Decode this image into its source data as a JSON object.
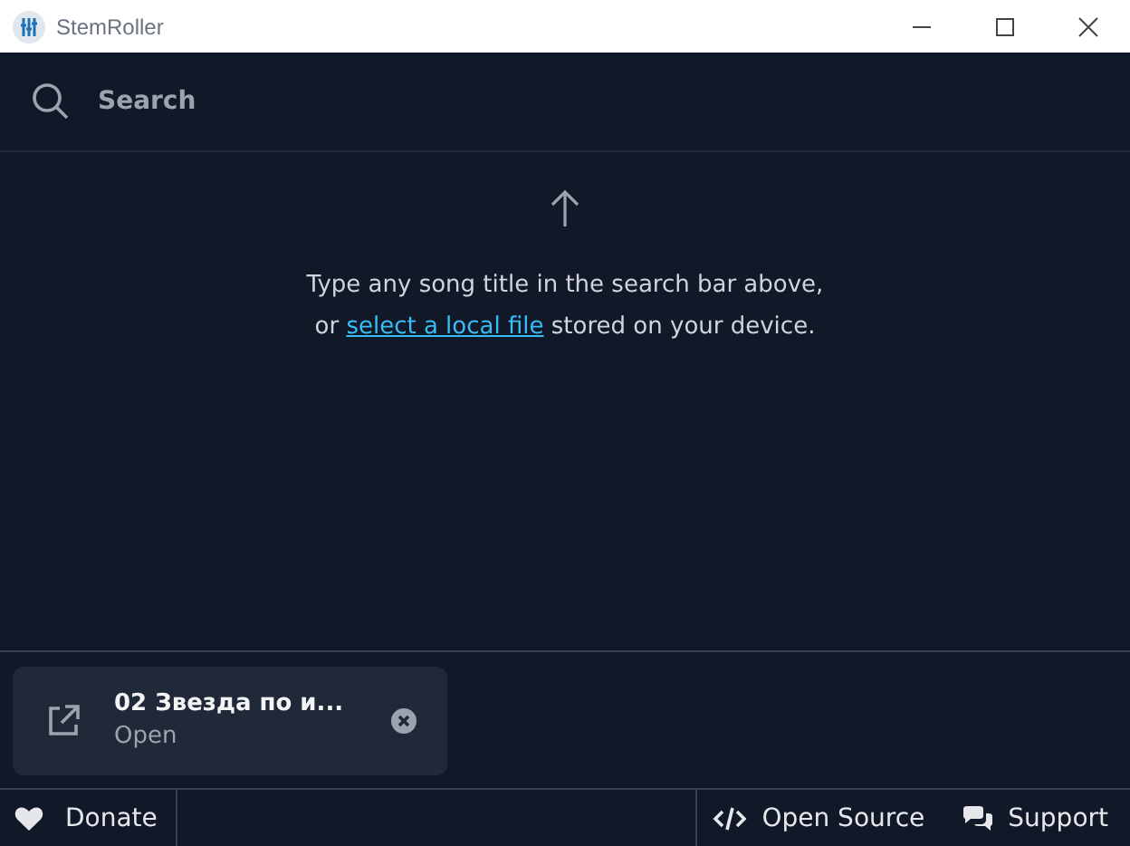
{
  "window": {
    "title": "StemRoller"
  },
  "search": {
    "placeholder": "Search"
  },
  "empty_state": {
    "line_1": "Type any song title in the search bar above,",
    "line_2_before": "or ",
    "link": "select a local file",
    "line_2_after": " stored on your device."
  },
  "queue": [
    {
      "title": "02 Звезда по и...",
      "status": "Open"
    }
  ],
  "footer": {
    "left": [
      {
        "kind": "heart",
        "label": "Donate"
      }
    ],
    "right": [
      {
        "kind": "code",
        "label": "Open Source"
      },
      {
        "kind": "chat",
        "label": "Support"
      }
    ]
  }
}
